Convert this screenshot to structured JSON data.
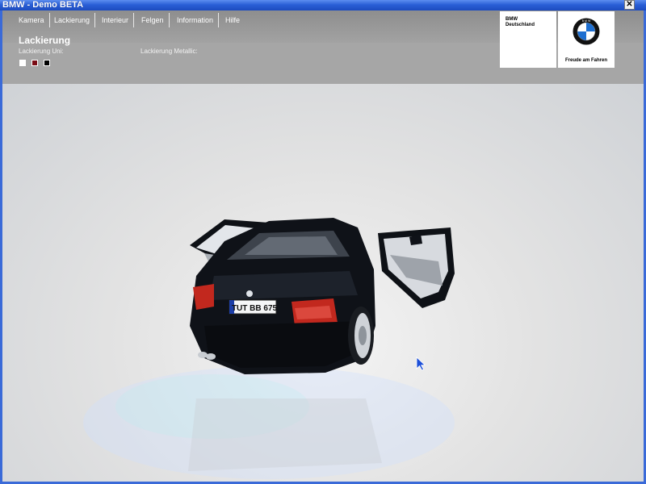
{
  "window": {
    "title": "BMW - Demo BETA",
    "close_label": "✕"
  },
  "menu": [
    {
      "label": "Kamera"
    },
    {
      "label": "Lackierung"
    },
    {
      "label": "Interieur"
    },
    {
      "label": "Felgen"
    },
    {
      "label": "Information"
    },
    {
      "label": "Hilfe"
    }
  ],
  "section": {
    "title": "Lackierung",
    "uni_label": "Lackierung Uni:",
    "metallic_label": "Lackierung Metallic:"
  },
  "swatches_uni": [
    {
      "color": "#ffffff"
    },
    {
      "color": "#7a0b14"
    },
    {
      "color": "#000000"
    }
  ],
  "brand": {
    "line1": "BMW",
    "line2": "Deutschland",
    "slogan": "Freude am Fahren"
  },
  "car": {
    "plate": "TUT BB 675",
    "colors": {
      "body": "#0f1218",
      "taillight": "#c2281e"
    }
  }
}
